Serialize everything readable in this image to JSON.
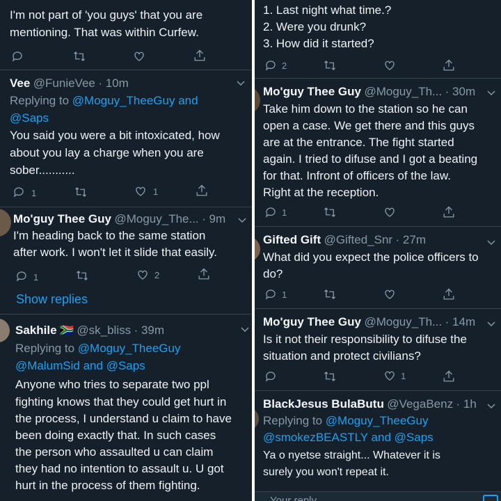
{
  "left": {
    "t0": {
      "body": [
        "I'm not part of 'you guys' that you are",
        "mentioning. That was within Curfew."
      ],
      "reply_count": "",
      "rt_count": "",
      "like_count": ""
    },
    "t1": {
      "name": "Vee",
      "handle": "@FunieVee",
      "time": "· 10m",
      "replying_prefix": "Replying to",
      "replying_to": "@Moguy_TheeGuy",
      "replying_and": "and",
      "replying_to2": "@Saps",
      "body": [
        "You said you were a bit intoxicated, how",
        "about you lay a charge when you are",
        "sober..........."
      ],
      "reply_count": "1",
      "like_count": "1"
    },
    "t2": {
      "name": "Mo'guy Thee Guy",
      "handle": "@Moguy_The...",
      "time": "· 9m",
      "body": [
        "I'm heading back to the same station",
        "after work. I won't let it slide that easily."
      ],
      "reply_count": "1",
      "like_count": "2",
      "show_replies": "Show replies"
    },
    "t3": {
      "name": "Sakhile",
      "flag": "🇿🇦",
      "handle": "@sk_bliss",
      "time": "· 39m",
      "replying_prefix": "Replying to",
      "replying_to": "@Moguy_TheeGuy",
      "replying_line2a": "@MalumSid",
      "replying_and": "and",
      "replying_line2b": "@Saps",
      "body": [
        "Anyone who tries to separate two ppl",
        "fighting knows that they could get hurt in",
        "the process, I understand u claim to have",
        "been doing exactly that. In such cases",
        "the person who assaulted u can claim",
        "they had no intention to assault u. U got",
        "hurt in the process of them fighting."
      ]
    }
  },
  "right": {
    "t0": {
      "body": [
        "1. Last night what time.?",
        "2. Were you drunk?",
        "3. How did it started?"
      ],
      "reply_count": "2"
    },
    "t1": {
      "name": "Mo'guy Thee Guy",
      "handle": "@Moguy_Th...",
      "time": "· 30m",
      "body": [
        "Take him down to the station so he can",
        "open a case. We get there and this guys",
        "are at the entrance. The fight started",
        "again. I tried to difuse and I got a beating",
        "for that. Infront of officers of the law.",
        "Right at the reception."
      ],
      "reply_count": "1"
    },
    "t2": {
      "name": "Gifted Gift",
      "handle": "@Gifted_Snr",
      "time": "· 27m",
      "body": [
        "What did you expect the police officers to",
        "do?"
      ],
      "reply_count": "1"
    },
    "t3": {
      "name": "Mo'guy Thee Guy",
      "handle": "@Moguy_Th...",
      "time": "· 14m",
      "body": [
        "Is it not their responsibility to difuse the",
        "situation and protect civilians?"
      ],
      "like_count": "1"
    },
    "t4": {
      "name": "BlackJesus BulaButu",
      "handle": "@VegaBenz",
      "time": "· 1h",
      "replying_prefix": "Replying to",
      "replying_to": "@Moguy_TheeGuy",
      "replying_line2a": "@smokezBEASTLY",
      "replying_and": "and",
      "replying_line2b": "@Saps",
      "body": [
        "Ya o nyetse straight... Whatever it is",
        "surely you won't repeat it."
      ]
    },
    "bottom_text": "Your reply"
  },
  "colors": {
    "bg": "#15202b",
    "link": "#1da1f2",
    "muted": "#8899a6",
    "divider": "#38444d"
  },
  "icons": [
    "reply-icon",
    "retweet-icon",
    "like-icon",
    "share-icon",
    "chevron-down-icon"
  ]
}
